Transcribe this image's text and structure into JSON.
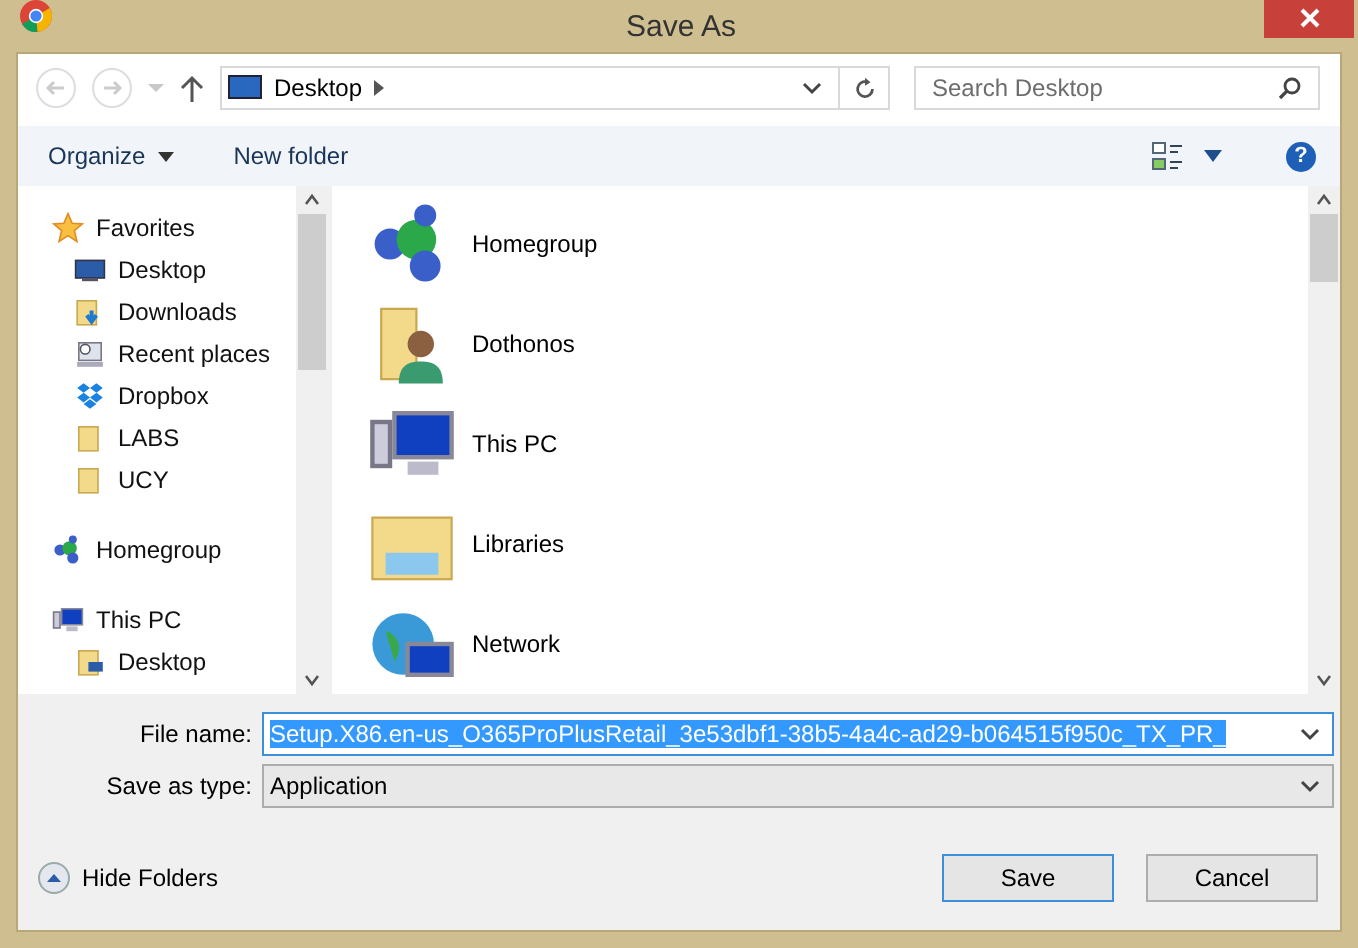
{
  "window": {
    "title": "Save As"
  },
  "navigation": {
    "path": "Desktop",
    "search_placeholder": "Search Desktop",
    "back_disabled": true,
    "forward_disabled": true
  },
  "toolbar": {
    "organize": "Organize",
    "new_folder": "New folder",
    "help": "?"
  },
  "sidebar": {
    "items": [
      {
        "label": "Favorites",
        "kind": "star",
        "children": [
          {
            "label": "Desktop",
            "kind": "desktop"
          },
          {
            "label": "Downloads",
            "kind": "downloads"
          },
          {
            "label": "Recent places",
            "kind": "recent"
          },
          {
            "label": "Dropbox",
            "kind": "dropbox"
          },
          {
            "label": "LABS",
            "kind": "folder"
          },
          {
            "label": "UCY",
            "kind": "folder"
          }
        ]
      },
      {
        "label": "Homegroup",
        "kind": "homegroup"
      },
      {
        "label": "This PC",
        "kind": "pc",
        "children": [
          {
            "label": "Desktop",
            "kind": "folder-desktop"
          }
        ]
      }
    ]
  },
  "items": [
    {
      "label": "Homegroup",
      "kind": "homegroup"
    },
    {
      "label": "Dothonos",
      "kind": "user-folder"
    },
    {
      "label": "This PC",
      "kind": "pc"
    },
    {
      "label": "Libraries",
      "kind": "libraries"
    },
    {
      "label": "Network",
      "kind": "network"
    }
  ],
  "form": {
    "file_name_label": "File name:",
    "file_name": "Setup.X86.en-us_O365ProPlusRetail_3e53dbf1-38b5-4a4c-ad29-b064515f950c_TX_PR_",
    "file_name_selected": true,
    "type_label": "Save as type:",
    "type": "Application"
  },
  "footer": {
    "hide_folders": "Hide Folders",
    "buttons": [
      {
        "label": "Save",
        "default": true
      },
      {
        "label": "Cancel",
        "default": false
      }
    ]
  }
}
